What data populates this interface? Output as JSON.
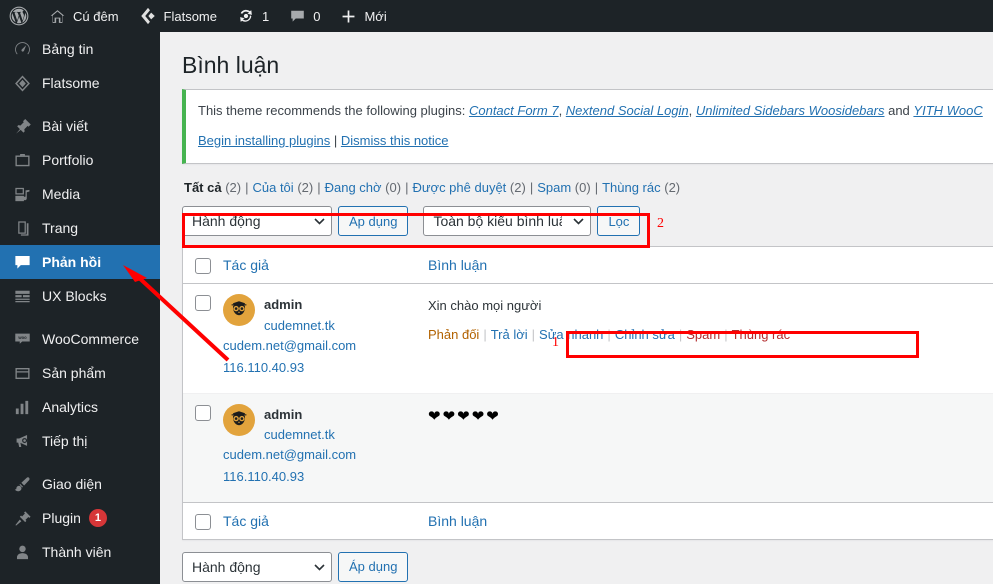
{
  "adminbar": {
    "items": [
      {
        "name": "wordpress-logo",
        "icon": "wordpress-icon",
        "label": ""
      },
      {
        "name": "site-name",
        "icon": "home-icon",
        "label": "Cú đêm"
      },
      {
        "name": "flatsome",
        "icon": "flatsome-icon",
        "label": "Flatsome"
      },
      {
        "name": "updates",
        "icon": "update-icon",
        "label": "1"
      },
      {
        "name": "comments",
        "icon": "comment-bubble-icon",
        "label": "0"
      },
      {
        "name": "new-content",
        "icon": "plus-icon",
        "label": "Mới"
      }
    ]
  },
  "sidebar": {
    "items": [
      {
        "label": "Bảng tin",
        "icon": "dashboard-icon",
        "current": false,
        "badge": ""
      },
      {
        "label": "Flatsome",
        "icon": "flatsome-icon",
        "current": false,
        "badge": ""
      },
      {
        "sep": true
      },
      {
        "label": "Bài viết",
        "icon": "pin-icon",
        "current": false,
        "badge": ""
      },
      {
        "label": "Portfolio",
        "icon": "portfolio-icon",
        "current": false,
        "badge": ""
      },
      {
        "label": "Media",
        "icon": "media-icon",
        "current": false,
        "badge": ""
      },
      {
        "label": "Trang",
        "icon": "page-icon",
        "current": false,
        "badge": ""
      },
      {
        "label": "Phản hồi",
        "icon": "comment-icon",
        "current": true,
        "badge": ""
      },
      {
        "label": "UX Blocks",
        "icon": "blocks-icon",
        "current": false,
        "badge": ""
      },
      {
        "sep": true
      },
      {
        "label": "WooCommerce",
        "icon": "woocommerce-icon",
        "current": false,
        "badge": ""
      },
      {
        "label": "Sản phẩm",
        "icon": "product-icon",
        "current": false,
        "badge": ""
      },
      {
        "label": "Analytics",
        "icon": "chart-icon",
        "current": false,
        "badge": ""
      },
      {
        "label": "Tiếp thị",
        "icon": "megaphone-icon",
        "current": false,
        "badge": ""
      },
      {
        "sep": true
      },
      {
        "label": "Giao diện",
        "icon": "brush-icon",
        "current": false,
        "badge": ""
      },
      {
        "label": "Plugin",
        "icon": "plugin-icon",
        "current": false,
        "badge": "1"
      },
      {
        "label": "Thành viên",
        "icon": "user-icon",
        "current": false,
        "badge": ""
      }
    ]
  },
  "page": {
    "title": "Bình luận"
  },
  "notice": {
    "intro": "This theme recommends the following plugins: ",
    "plugins": [
      {
        "name": "Contact Form 7",
        "after": ", "
      },
      {
        "name": "Nextend Social Login",
        "after": ", "
      },
      {
        "name": "Unlimited Sidebars Woosidebars",
        "after": " and "
      },
      {
        "name": "YITH WooC",
        "after": ""
      }
    ],
    "actions": {
      "install": "Begin installing plugins",
      "separator": " | ",
      "dismiss": "Dismiss this notice"
    }
  },
  "filters": [
    {
      "label": "Tất cả",
      "count": "(2)",
      "current": true
    },
    {
      "label": "Của tôi",
      "count": "(2)",
      "current": false
    },
    {
      "label": "Đang chờ",
      "count": "(0)",
      "current": false
    },
    {
      "label": "Được phê duyệt",
      "count": "(2)",
      "current": false
    },
    {
      "label": "Spam",
      "count": "(0)",
      "current": false
    },
    {
      "label": "Thùng rác",
      "count": "(2)",
      "current": false
    }
  ],
  "toolbar_top": {
    "bulk_action_value": "Hành động",
    "apply_label": "Áp dụng",
    "comment_type_value": "Toàn bộ kiểu bình luận",
    "filter_label": "Lọc"
  },
  "toolbar_bottom": {
    "bulk_action_value": "Hành động",
    "apply_label": "Áp dụng"
  },
  "table": {
    "headers": {
      "author": "Tác giả",
      "comment": "Bình luận"
    },
    "rows": [
      {
        "author_name": "admin",
        "author_site": "cudemnet.tk",
        "author_email": "cudem.net@gmail.com",
        "author_ip": "116.110.40.93",
        "comment_text": "Xin chào mọi người",
        "hearts": "",
        "actions": {
          "unapprove": "Phản đối",
          "reply": "Trả lời",
          "quickedit": "Sửa nhanh",
          "edit": "Chỉnh sửa",
          "spam": "Spam",
          "trash": "Thùng rác"
        }
      },
      {
        "author_name": "admin",
        "author_site": "cudemnet.tk",
        "author_email": "cudem.net@gmail.com",
        "author_ip": "116.110.40.93",
        "comment_text": "",
        "hearts": "❤❤❤❤❤",
        "actions": null
      }
    ]
  },
  "annotations": {
    "color": "#ff0000",
    "marks": [
      {
        "id": "1",
        "target": "row-actions"
      },
      {
        "id": "2",
        "target": "top-toolbar"
      }
    ]
  }
}
